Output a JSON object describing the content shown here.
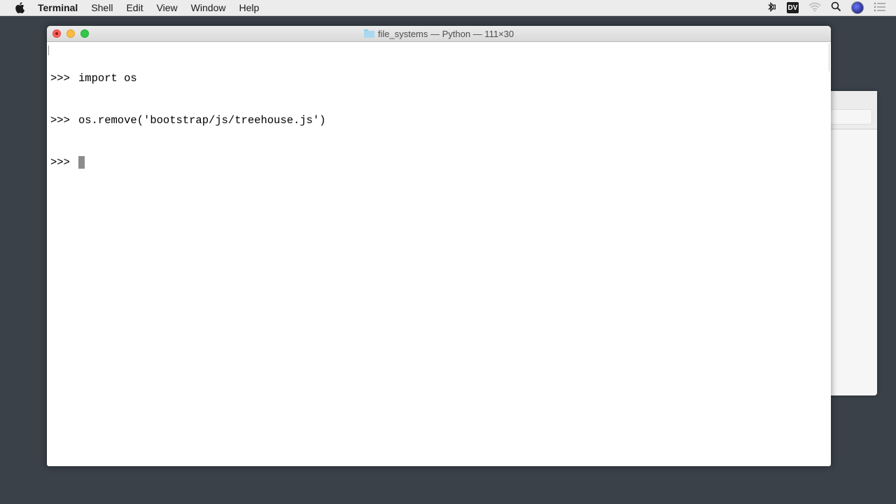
{
  "menubar": {
    "app_name": "Terminal",
    "items": [
      "Shell",
      "Edit",
      "View",
      "Window",
      "Help"
    ],
    "status_icons": [
      "bluetooth-icon",
      "dv-badge",
      "wifi-icon",
      "spotlight-search-icon",
      "user-avatar-icon",
      "notification-center-icon"
    ],
    "dv_label": "DV"
  },
  "window": {
    "title": "file_systems — Python — 111×30",
    "lines": [
      {
        "prompt": ">>>",
        "text": "import os"
      },
      {
        "prompt": ">>>",
        "text": "os.remove('bootstrap/js/treehouse.js')"
      },
      {
        "prompt": ">>>",
        "text": ""
      }
    ]
  },
  "colors": {
    "desktop": "#3a4149",
    "close": "#fc605c",
    "minimize": "#fdbc40",
    "maximize": "#34c84a",
    "cursor": "#8c8c8c"
  }
}
